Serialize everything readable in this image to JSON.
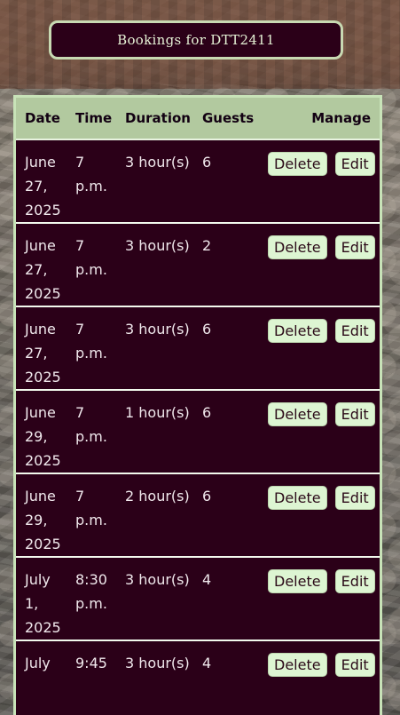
{
  "header": {
    "title": "Bookings for DTT2411"
  },
  "table": {
    "columns": [
      "Date",
      "Time",
      "Duration",
      "Guests",
      "Manage"
    ],
    "delete_label": "Delete",
    "edit_label": "Edit",
    "rows": [
      {
        "date": "June 27, 2025",
        "time": "7 p.m.",
        "duration": "3 hour(s)",
        "guests": "6"
      },
      {
        "date": "June 27, 2025",
        "time": "7 p.m.",
        "duration": "3 hour(s)",
        "guests": "2"
      },
      {
        "date": "June 27, 2025",
        "time": "7 p.m.",
        "duration": "3 hour(s)",
        "guests": "6"
      },
      {
        "date": "June 29, 2025",
        "time": "7 p.m.",
        "duration": "1 hour(s)",
        "guests": "6"
      },
      {
        "date": "June 29, 2025",
        "time": "7 p.m.",
        "duration": "2 hour(s)",
        "guests": "6"
      },
      {
        "date": "July 1, 2025",
        "time": "8:30 p.m.",
        "duration": "3 hour(s)",
        "guests": "4"
      },
      {
        "date": "July",
        "time": "9:45",
        "duration": "3 hour(s)",
        "guests": "4"
      }
    ]
  }
}
